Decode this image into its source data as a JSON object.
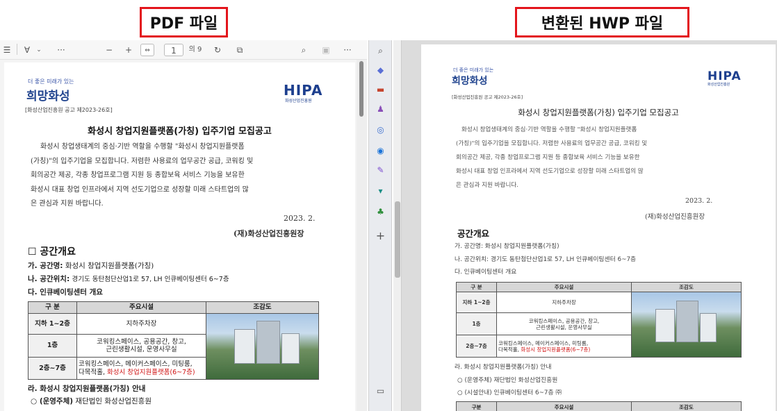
{
  "labels": {
    "pdf": "PDF 파일",
    "hwp": "변환된 HWP 파일"
  },
  "pdf_toolbar": {
    "page_current": "1",
    "page_total": "의 9",
    "zoom_out": "−",
    "zoom_in": "+",
    "more": "···"
  },
  "doc": {
    "slogan": "더 좋은 미래가 있는",
    "city_logo": "희망화성",
    "hipa_logo": "HIPA",
    "hipa_sub": "화성산업진흥원",
    "notice_no": "[화성산업진흥원 공고 제2023-26호]",
    "title": "화성시 창업지원플랫폼(가칭) 입주기업 모집공고",
    "intro_lines_pdf": [
      "화성시 창업생태계의 중심·기반 역할을 수행할 \"화성시 창업지원플랫폼",
      "(가칭)\"의 입주기업을 모집합니다. 저렴한 사용료의 업무공간 공급, 코워킹 및",
      "회의공간 제공, 각종 창업프로그램 지원 등 종합보육 서비스 기능을 보유한",
      "화성시 대표 창업 인프라에서 지역 선도기업으로 성장할 미래 스타트업의 많",
      "은 관심과 지원 바랍니다."
    ],
    "intro_lines_hwp": [
      "화성시 창업생태계의 중심·기반 역할을 수행할 \"화성시 창업지원플랫폼",
      "(가칭)\"의 입주기업을 모집합니다. 저렴한 사용료의 업무공간 공급, 코워킹 및",
      "회의공간 제공, 각종 창업프로그램 지원 등 종합보육 서비스 기능을 보유한",
      "화성시 대표 창업 인프라에서 지역 선도기업으로 성장할 미래 스타트업의 많",
      "은 관심과 지원 바랍니다."
    ],
    "date": "2023. 2.",
    "org": "(재)화성산업진흥원장",
    "section_pdf": "☐ 공간개요",
    "section_hwp": "공간개요",
    "item_ga_label": "가. 공간명:",
    "item_ga_value": "화성시 창업지원플랫폼(가칭)",
    "item_na_label": "나. 공간위치:",
    "item_na_value": "경기도 동탄첨단산업1로 57, LH 인큐베이팅센터 6~7층",
    "item_na_value_hwp": "경기도 동탄첨단산업1로 57, LH 인큐베이팅센터 6~7층",
    "item_da": "다. 인큐베이팅센터 개요",
    "table": {
      "headers": [
        "구 분",
        "주요시설",
        "조감도"
      ],
      "rows": [
        {
          "floor": "지하 1~2층",
          "facility": "지하주차장"
        },
        {
          "floor": "1층",
          "facility": "코워킹스페이스, 공용공간, 창고,",
          "facility2": "근린생활시설, 운영사무실"
        },
        {
          "floor": "2층~7층",
          "facility": "코워킹스페이스, 메이커스페이스, 미팅룸,",
          "facility2_plain": "다목적홀, ",
          "facility2_red": "화성시 창업지원플랫폼(6~7층)"
        }
      ]
    },
    "item_ra": "라. 화성시 창업지원플랫폼(가칭) 안내",
    "item_ra_hwp": "라. 화성시 창업지원플랫폼(가칭) 안내",
    "op_label": "○ (운영주체)",
    "op_value": "재단법인 화성산업진흥원",
    "loc_label": "○ (시설안내)",
    "loc_value": "인큐베이팅센터 6~7층 ㈜",
    "table2_headers": [
      "구분",
      "주요시설",
      "조감도"
    ]
  },
  "side_icons": [
    "search-icon",
    "bookmark-icon",
    "briefcase-icon",
    "people-icon",
    "shape-icon",
    "outlook-icon",
    "edit-icon",
    "shop-icon",
    "tree-icon",
    "plus-icon",
    "panel-icon"
  ]
}
